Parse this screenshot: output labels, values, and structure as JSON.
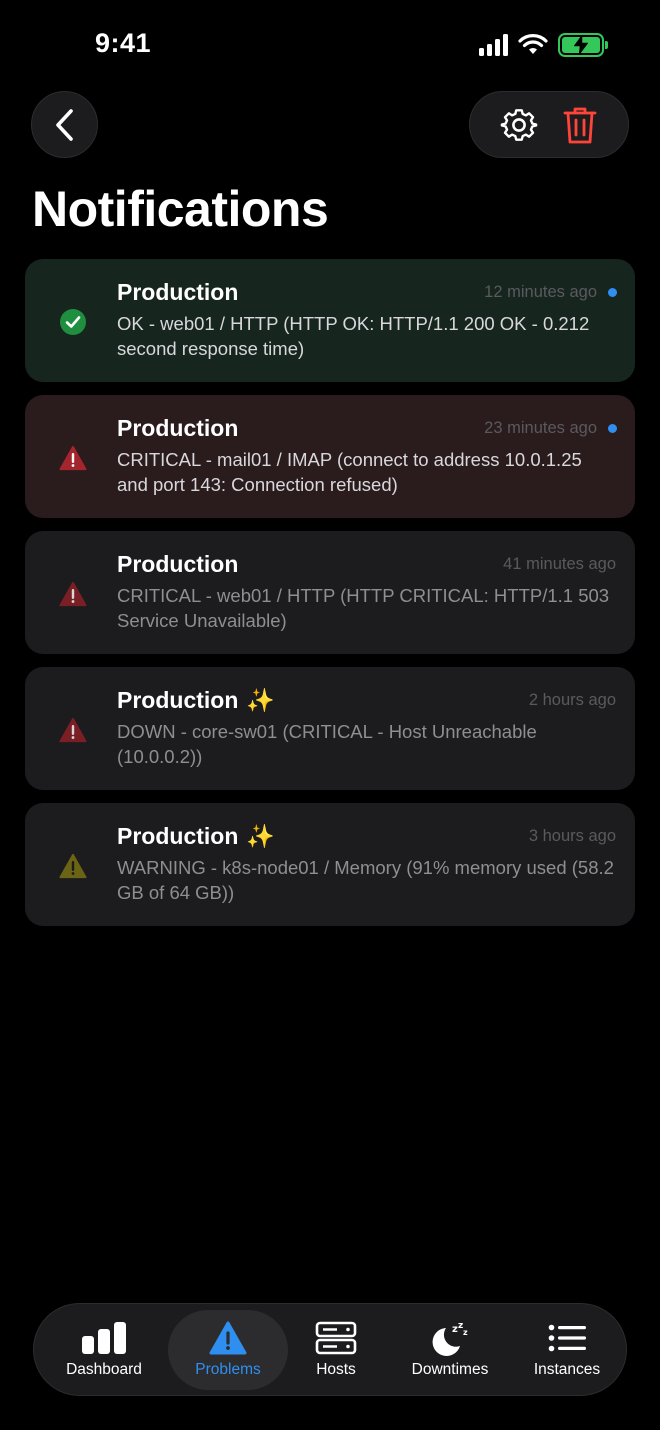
{
  "status_bar": {
    "time": "9:41"
  },
  "header": {
    "title": "Notifications"
  },
  "notifications": [
    {
      "title": "Production",
      "time": "12 minutes ago",
      "message": "OK - web01 / HTTP (HTTP OK: HTTP/1.1 200 OK - 0.212 second response time)",
      "status": "ok",
      "unread": true
    },
    {
      "title": "Production",
      "time": "23 minutes ago",
      "message": "CRITICAL - mail01 / IMAP (connect to address 10.0.1.25 and port 143: Connection refused)",
      "status": "critical",
      "unread": true
    },
    {
      "title": "Production",
      "time": "41 minutes ago",
      "message": "CRITICAL - web01 / HTTP (HTTP CRITICAL: HTTP/1.1 503 Service Unavailable)",
      "status": "critical",
      "unread": false
    },
    {
      "title": "Production",
      "sparkle": "✨",
      "time": "2 hours ago",
      "message": "DOWN - core-sw01 (CRITICAL - Host Unreachable (10.0.0.2))",
      "status": "critical",
      "unread": false
    },
    {
      "title": "Production",
      "sparkle": "✨",
      "time": "3 hours ago",
      "message": "WARNING - k8s-node01 / Memory (91% memory used (58.2 GB of 64 GB))",
      "status": "warning",
      "unread": false
    }
  ],
  "tabs": [
    {
      "label": "Dashboard",
      "icon": "bar-chart-icon",
      "active": false
    },
    {
      "label": "Problems",
      "icon": "warning-icon",
      "active": true
    },
    {
      "label": "Hosts",
      "icon": "server-icon",
      "active": false
    },
    {
      "label": "Downtimes",
      "icon": "moon-zzz-icon",
      "active": false
    },
    {
      "label": "Instances",
      "icon": "list-icon",
      "active": false
    }
  ],
  "colors": {
    "accent": "#2f8ff0",
    "ok": "#34c759",
    "critical": "#ff453a",
    "warning": "#ffd60a",
    "delete": "#ff453a"
  }
}
